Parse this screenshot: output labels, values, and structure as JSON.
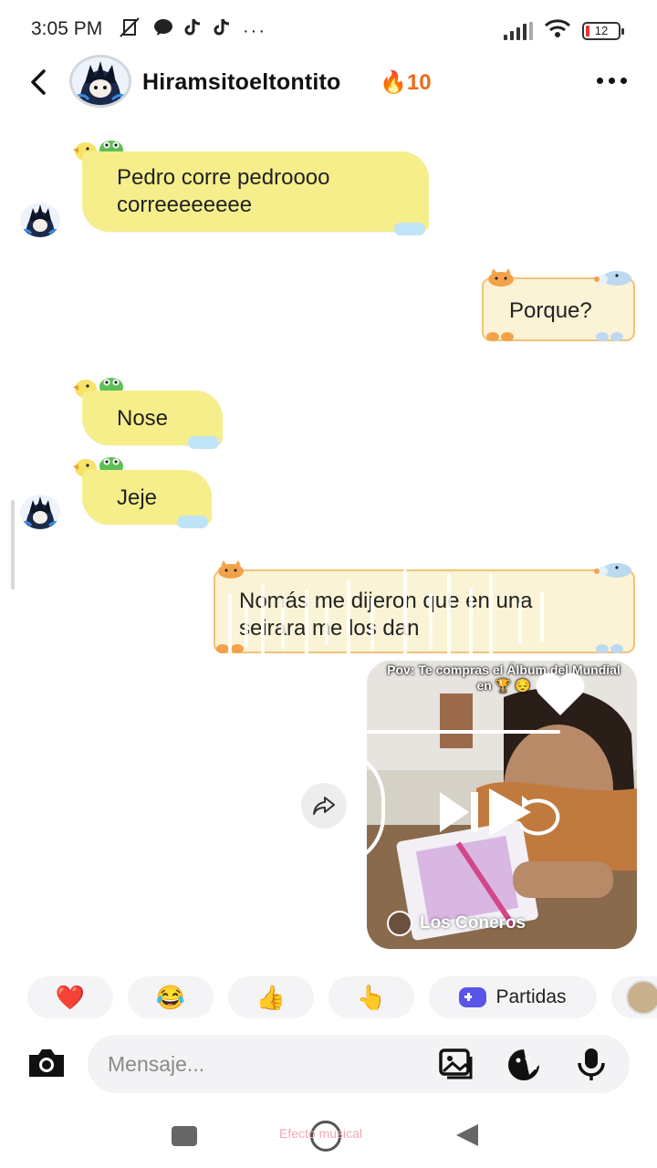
{
  "status_bar": {
    "time": "3:05 PM",
    "battery": "12",
    "icons_left": [
      "mute-vibrate-icon",
      "messenger-icon",
      "tiktok-icon",
      "tiktok-icon",
      "more-icon"
    ]
  },
  "header": {
    "name": "Hiramsitoeltontito",
    "streak_icon": "🔥",
    "streak_count": "10"
  },
  "messages": [
    {
      "from": "them",
      "text_lines": [
        "Pedro corre pedroooo",
        "correeeeeeee"
      ]
    },
    {
      "from": "me",
      "text": "Porque?"
    },
    {
      "from": "them",
      "text": "Nose"
    },
    {
      "from": "them",
      "text": "Jeje"
    },
    {
      "from": "me",
      "text_lines": [
        "Nomás me dijeron que en una",
        "seirara me los dan"
      ]
    }
  ],
  "shared_video": {
    "caption": "Pov: Te compras el Álbum del Mundial en 🏆 😔",
    "author": "Los Coneros"
  },
  "quick_replies": {
    "heart": "❤️",
    "laugh": "😂",
    "thumbs_up": "👍",
    "point": "👆",
    "games_label": "Partidas"
  },
  "input": {
    "placeholder": "Mensaje..."
  },
  "nav": {
    "overlay_text": "Efecto musical"
  },
  "colors": {
    "bubble_yellow": "#f6ee8a",
    "bubble_cream": "#fbf3d6",
    "streak": "#f06a1c",
    "games_accent": "#5a55e8"
  }
}
